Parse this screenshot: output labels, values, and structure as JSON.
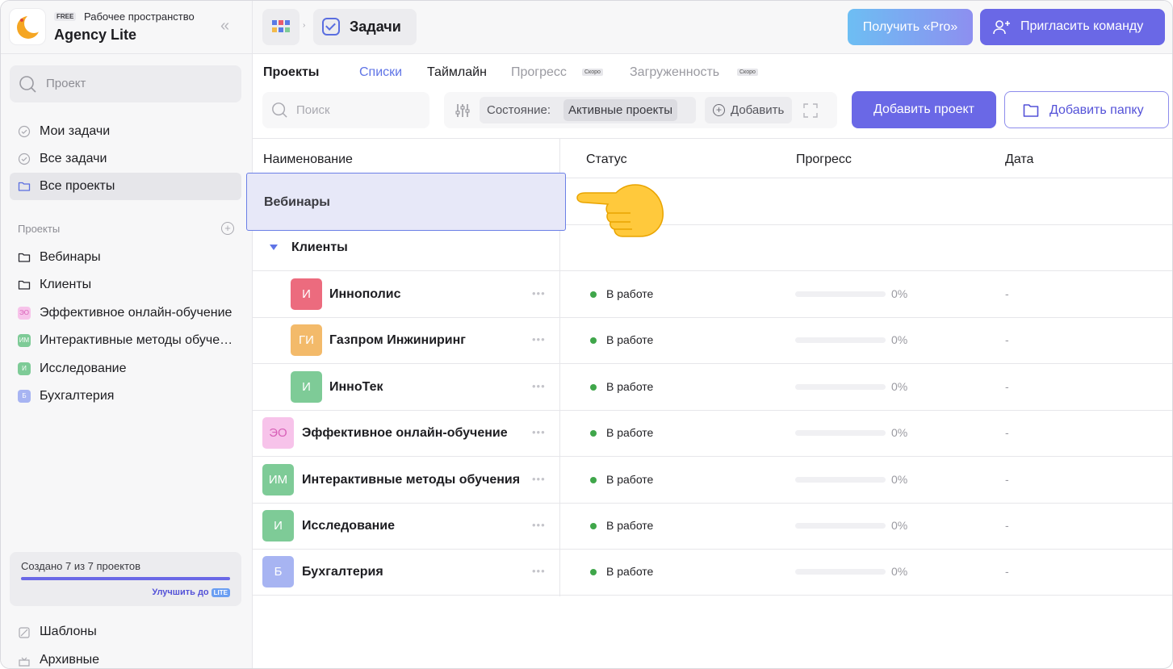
{
  "workspace": {
    "badge": "FREE",
    "subtitle": "Рабочее пространство",
    "name": "Agency Lite"
  },
  "sidebar": {
    "search_placeholder": "Проект",
    "nav": [
      {
        "label": "Мои задачи",
        "icon": "check-circle-icon"
      },
      {
        "label": "Все задачи",
        "icon": "check-circle-icon"
      },
      {
        "label": "Все проекты",
        "icon": "folder-icon",
        "active": true
      }
    ],
    "projects_label": "Проекты",
    "projects": [
      {
        "label": "Вебинары",
        "icon": "folder-icon"
      },
      {
        "label": "Клиенты",
        "icon": "folder-icon"
      },
      {
        "label": "Эффективное онлайн-обучение",
        "abbr": "ЭО",
        "color": "#f3a6dc"
      },
      {
        "label": "Интерактивные методы обучения",
        "abbr": "ИМ",
        "color": "#7ecb97"
      },
      {
        "label": "Исследование",
        "abbr": "И",
        "color": "#7ecb97"
      },
      {
        "label": "Бухгалтерия",
        "abbr": "Б",
        "color": "#a7b4f2"
      }
    ],
    "quota": {
      "text": "Создано 7 из 7 проектов",
      "progress": 1.0,
      "upgrade": "Улучшить до",
      "upgrade_badge": "LITE"
    },
    "bottom": [
      {
        "label": "Шаблоны",
        "icon": "template-icon"
      },
      {
        "label": "Архивные",
        "icon": "archive-icon"
      }
    ]
  },
  "topbar": {
    "current": "Задачи",
    "pro_label": "Получить «Pro»",
    "invite_label": "Пригласить команду"
  },
  "tabs": {
    "projects": "Проекты",
    "lists": "Списки",
    "timeline": "Таймлайн",
    "progress": "Прогресс",
    "workload": "Загруженность",
    "soon": "Скоро"
  },
  "filters": {
    "search_placeholder": "Поиск",
    "state_key": "Состояние:",
    "state_value": "Активные проекты",
    "add_label": "Добавить"
  },
  "actions": {
    "add_project": "Добавить проект",
    "add_folder": "Добавить папку"
  },
  "table": {
    "columns": {
      "name": "Наименование",
      "status": "Статус",
      "progress": "Прогресс",
      "date": "Дата"
    },
    "dragged_row": "Вебинары",
    "group": "Клиенты",
    "rows": [
      {
        "abbr": "И",
        "name": "Иннополис",
        "color": "#ec6b7e",
        "status": "В работе",
        "progress": "0%",
        "date": "-",
        "indent": true
      },
      {
        "abbr": "ГИ",
        "name": "Газпром Инжиниринг",
        "color": "#f3ba6a",
        "status": "В работе",
        "progress": "0%",
        "date": "-",
        "indent": true
      },
      {
        "abbr": "И",
        "name": "ИнноТек",
        "color": "#7ecb97",
        "status": "В работе",
        "progress": "0%",
        "date": "-",
        "indent": true
      },
      {
        "abbr": "ЭО",
        "name": "Эффективное онлайн-обучение",
        "color": "#f7c3ea",
        "text_color": "#d860b8",
        "status": "В работе",
        "progress": "0%",
        "date": "-",
        "indent": false
      },
      {
        "abbr": "ИМ",
        "name": "Интерактивные методы обучения",
        "color": "#7ecb97",
        "status": "В работе",
        "progress": "0%",
        "date": "-",
        "indent": false
      },
      {
        "abbr": "И",
        "name": "Исследование",
        "color": "#7ecb97",
        "status": "В работе",
        "progress": "0%",
        "date": "-",
        "indent": false
      },
      {
        "abbr": "Б",
        "name": "Бухгалтерия",
        "color": "#a7b4f2",
        "status": "В работе",
        "progress": "0%",
        "date": "-",
        "indent": false
      }
    ]
  }
}
